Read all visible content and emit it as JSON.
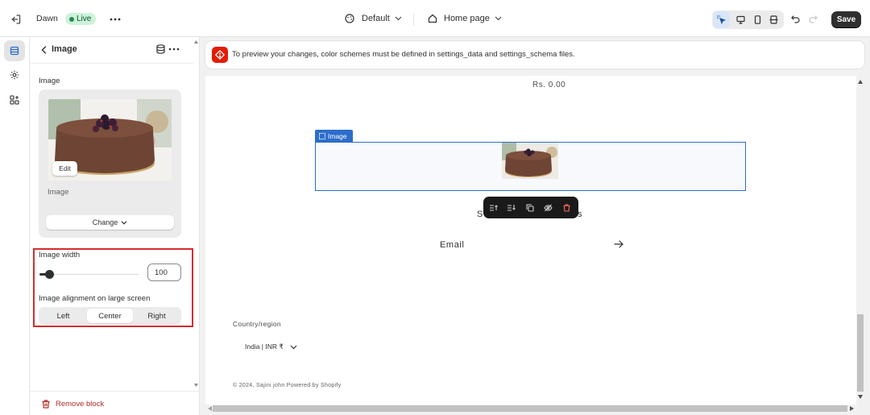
{
  "topbar": {
    "theme_name": "Dawn",
    "live_badge": "Live",
    "template": "Default",
    "page": "Home page",
    "save_label": "Save"
  },
  "panel": {
    "title": "Image",
    "image_field_label": "Image",
    "edit_label": "Edit",
    "image_caption": "Image",
    "change_label": "Change",
    "image_width_label": "Image width",
    "image_width_value": "100",
    "image_width_percent": 10,
    "alignment_label": "Image alignment on large screen",
    "alignment_options": [
      "Left",
      "Center",
      "Right"
    ],
    "alignment_selected": "Center",
    "remove_label": "Remove block"
  },
  "notice": {
    "text": "To preview your changes, color schemes must be defined in settings_data and settings_schema files."
  },
  "preview": {
    "price": "Rs. 0.00",
    "image_tag": "Image",
    "subscribe_partial_left": "S",
    "subscribe_partial_right": "s",
    "email_label": "Email",
    "country_label": "Country/region",
    "country_value": "India | INR ₹",
    "copyright": "© 2024, Sajini john Powered by Shopify"
  },
  "colors": {
    "accent_blue": "#2c6ecb",
    "save_bg": "#303030",
    "highlight_red": "#d72c2c",
    "live_green": "#29845a",
    "remove_red": "#b52b26"
  },
  "icons": [
    "exit-icon",
    "more-icon",
    "theme-icon",
    "home-icon",
    "chevron-down-icon",
    "inspector-icon",
    "desktop-icon",
    "mobile-icon",
    "fullscreen-icon",
    "undo-icon",
    "redo-icon",
    "sections-icon",
    "gear-icon",
    "apps-icon",
    "back-icon",
    "database-icon",
    "trash-icon",
    "alert-icon",
    "arrow-right-icon"
  ]
}
